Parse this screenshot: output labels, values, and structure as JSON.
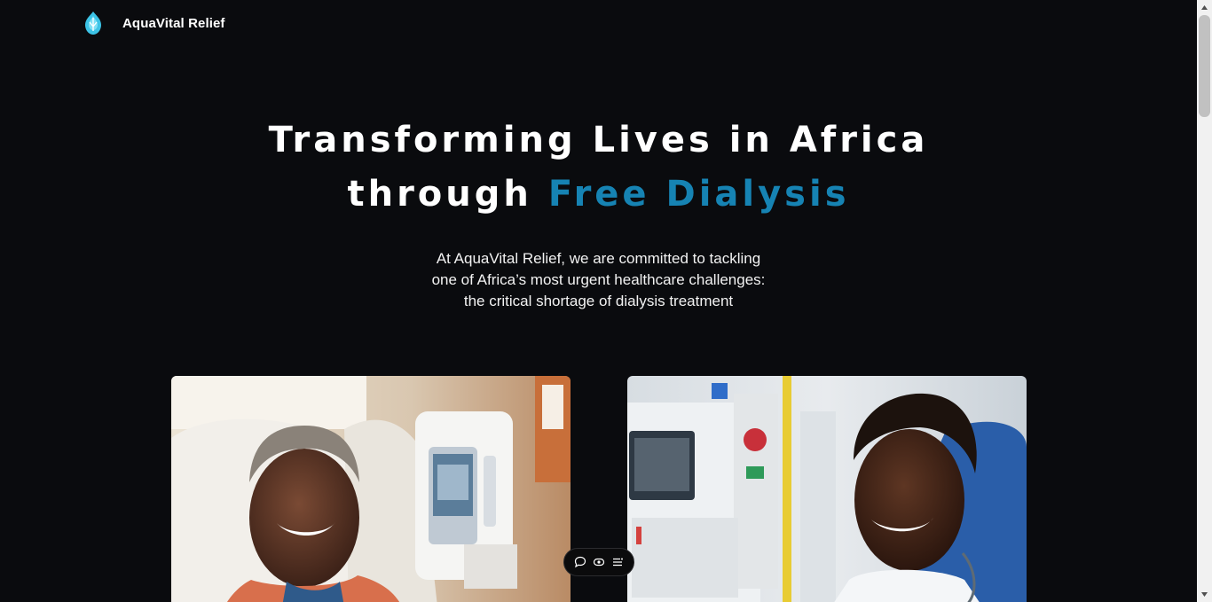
{
  "brand": {
    "name": "AquaVital Relief",
    "logo_icon": "water-drop-lotus-icon",
    "logo_color": "#3cc3e6"
  },
  "hero": {
    "title_line1": "Transforming Lives in Africa",
    "title_line2_prefix": "through ",
    "title_line2_accent": "Free Dialysis",
    "accent_color": "#1683b3",
    "subtitle_line1": "At AquaVital Relief, we are committed to tackling",
    "subtitle_line2": "one of Africa’s most urgent healthcare challenges:",
    "subtitle_line3": "the critical shortage of dialysis treatment"
  },
  "cards": [
    {
      "image": "woman-smiling-dialysis-chair-photo"
    },
    {
      "image": "man-smiling-dialysis-machine-photo"
    }
  ],
  "floating_toolbar": {
    "icons": [
      "chat-bubble-icon",
      "eye-icon",
      "menu-lines-icon"
    ]
  },
  "colors": {
    "background": "#0a0b0e",
    "text": "#ffffff"
  }
}
